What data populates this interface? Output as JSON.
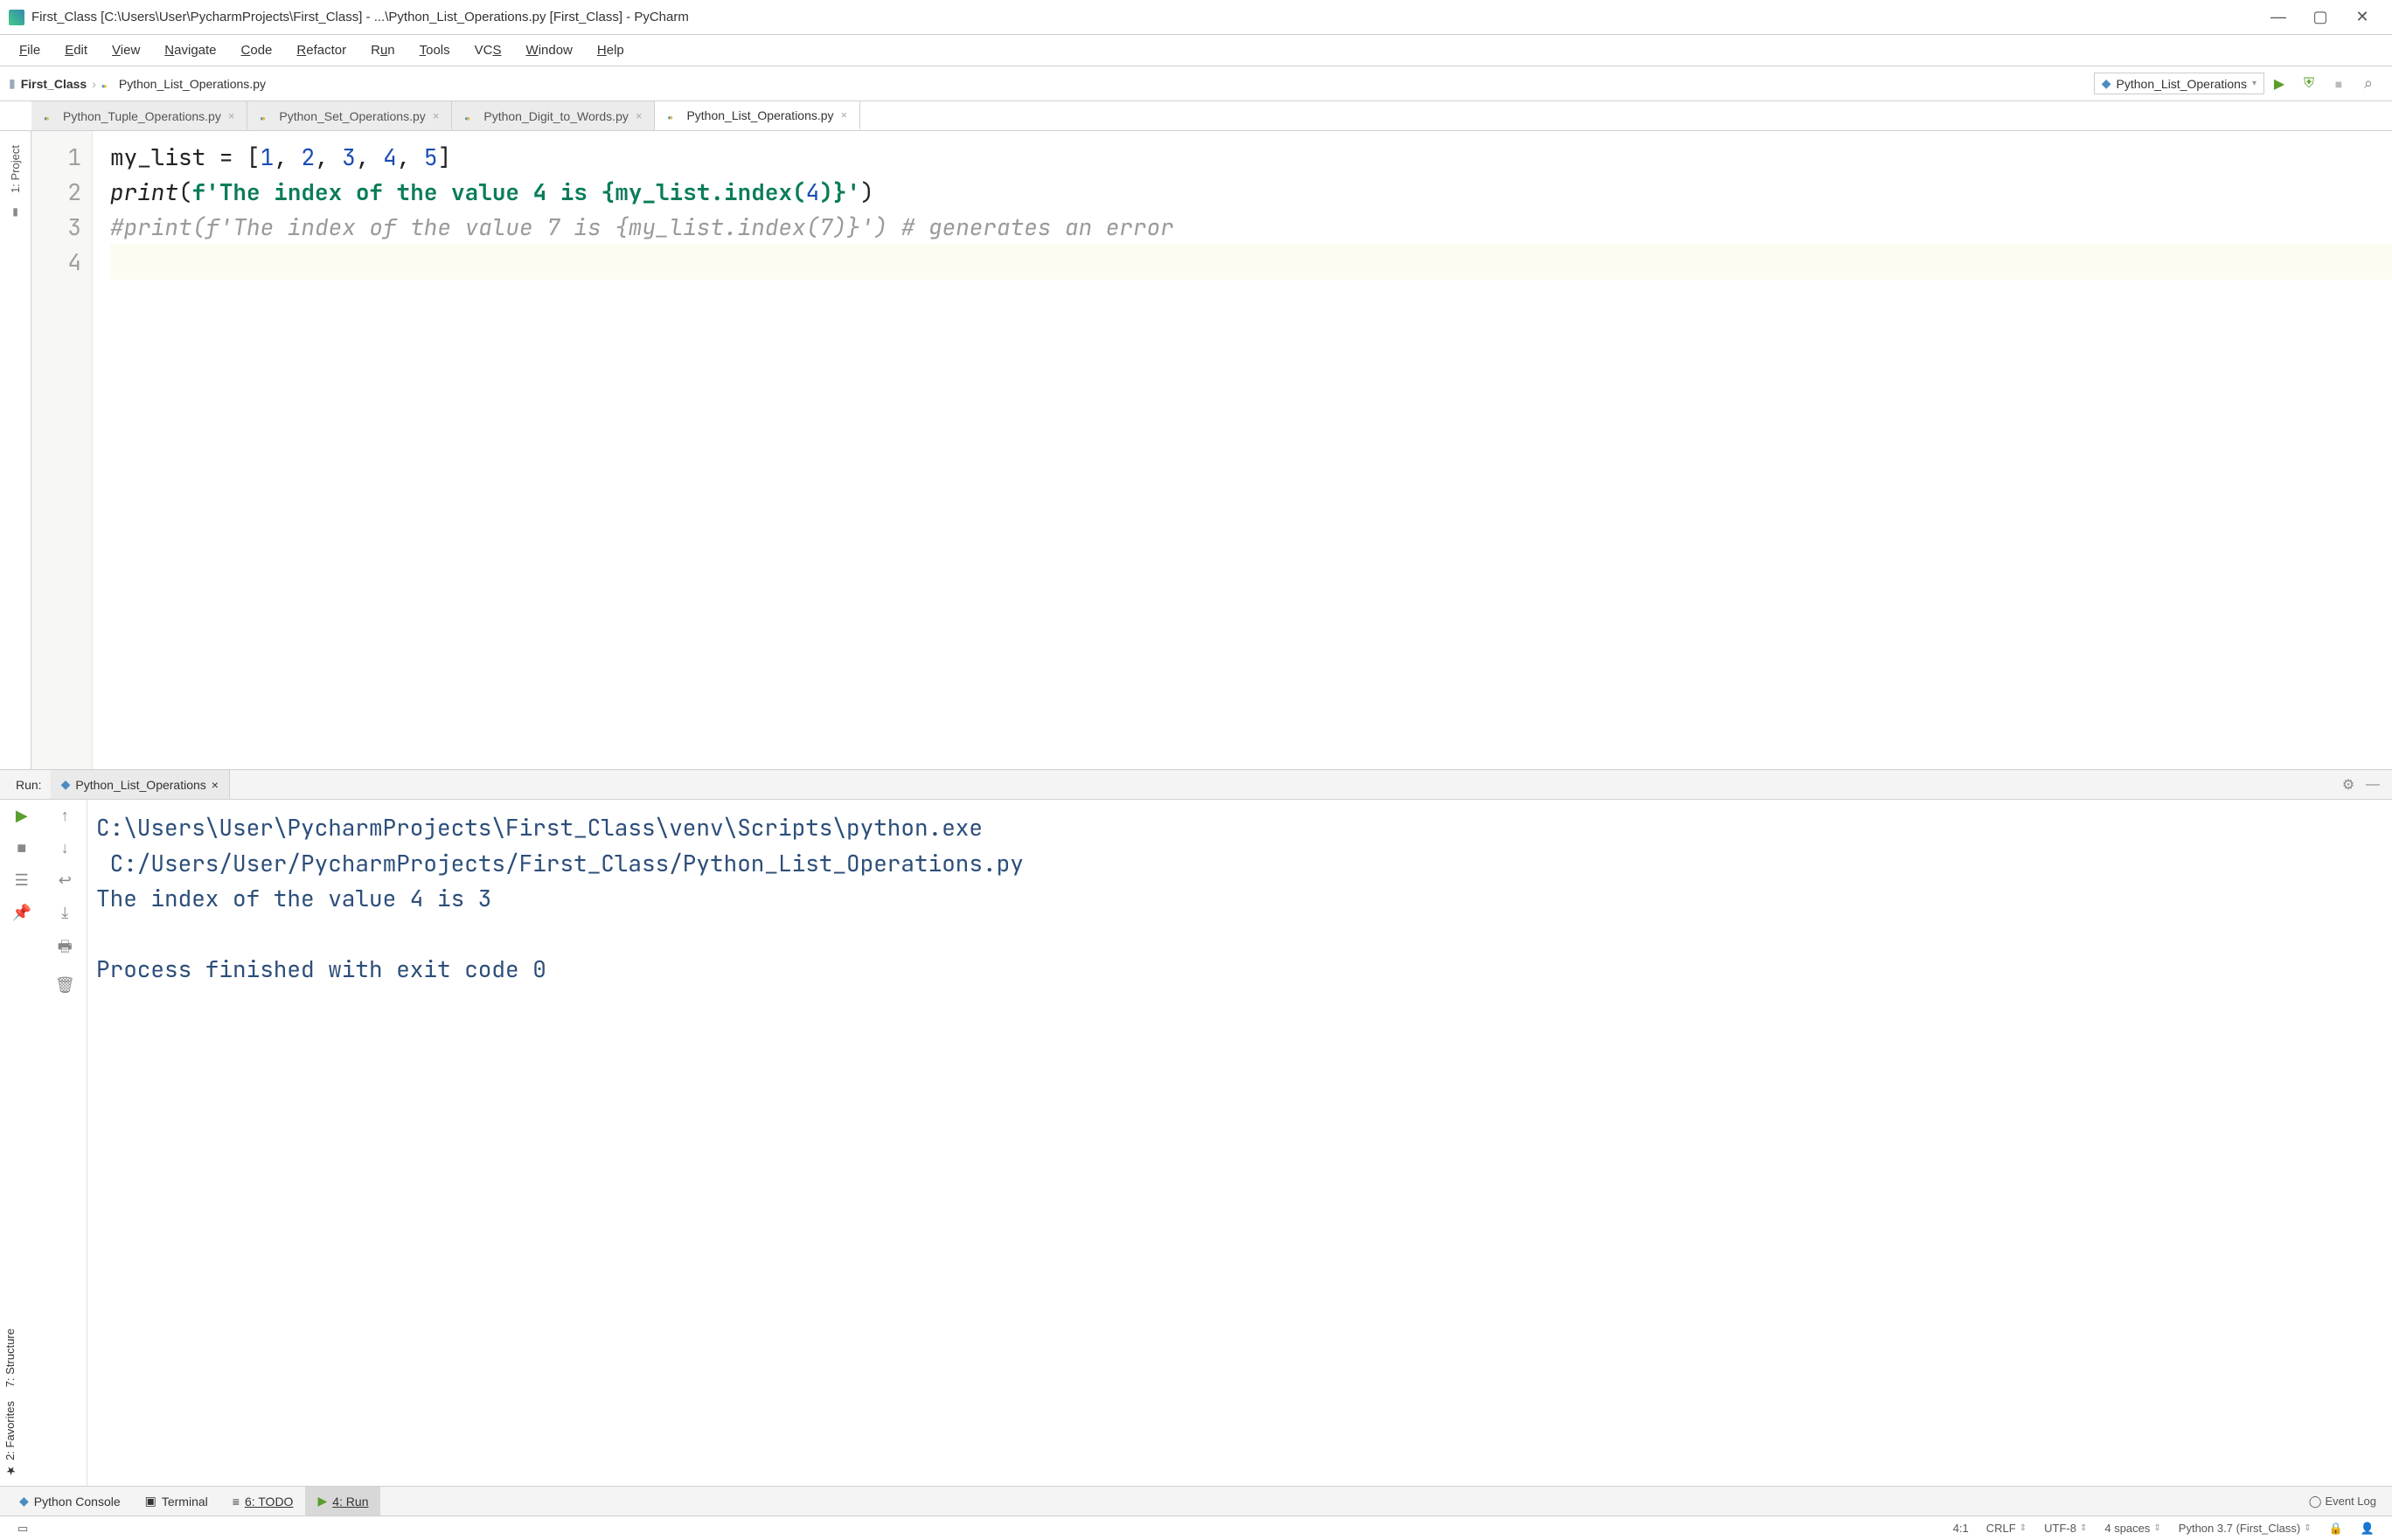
{
  "title": "First_Class [C:\\Users\\User\\PycharmProjects\\First_Class] - ...\\Python_List_Operations.py [First_Class] - PyCharm",
  "menubar": [
    "File",
    "Edit",
    "View",
    "Navigate",
    "Code",
    "Refactor",
    "Run",
    "Tools",
    "VCS",
    "Window",
    "Help"
  ],
  "breadcrumb": {
    "project": "First_Class",
    "file": "Python_List_Operations.py"
  },
  "run_config": "Python_List_Operations",
  "tabs": [
    {
      "label": "Python_Tuple_Operations.py",
      "active": false
    },
    {
      "label": "Python_Set_Operations.py",
      "active": false
    },
    {
      "label": "Python_Digit_to_Words.py",
      "active": false
    },
    {
      "label": "Python_List_Operations.py",
      "active": true
    }
  ],
  "left_tools": {
    "project": "1: Project"
  },
  "left_tools_bottom": [
    {
      "id": "structure",
      "label": "7: Structure"
    },
    {
      "id": "favorites",
      "label": "2: Favorites"
    }
  ],
  "code_lines": [
    "1",
    "2",
    "3",
    "4"
  ],
  "code": {
    "l1a": "my_list ",
    "l1b": "= [",
    "l1n1": "1",
    "l1c": ", ",
    "l1n2": "2",
    "l1d": ", ",
    "l1n3": "3",
    "l1e": ", ",
    "l1n4": "4",
    "l1f": ", ",
    "l1n5": "5",
    "l1g": "]",
    "l2a": "print",
    "l2b": "(",
    "l2c": "f'",
    "l2d": "The index of the value 4 is ",
    "l2e": "{my_list.index(",
    "l2f": "4",
    "l2g": ")}",
    "l2h": "'",
    "l2i": ")",
    "l3": "#print(f'The index of the value 7 is {my_list.index(7)}') # generates an error"
  },
  "run": {
    "label": "Run:",
    "tab": "Python_List_Operations",
    "out1": "C:\\Users\\User\\PycharmProjects\\First_Class\\venv\\Scripts\\python.exe",
    "out2": " C:/Users/User/PycharmProjects/First_Class/Python_List_Operations.py",
    "out3": "The index of the value 4 is 3",
    "out4": "Process finished with exit code 0"
  },
  "bottombar": {
    "console": "Python Console",
    "terminal": "Terminal",
    "todo": "6: TODO",
    "run_tab": "4: Run",
    "event_log": "Event Log"
  },
  "status": {
    "pos": "4:1",
    "eol": "CRLF",
    "enc": "UTF-8",
    "indent": "4 spaces",
    "interp": "Python 3.7 (First_Class)"
  }
}
